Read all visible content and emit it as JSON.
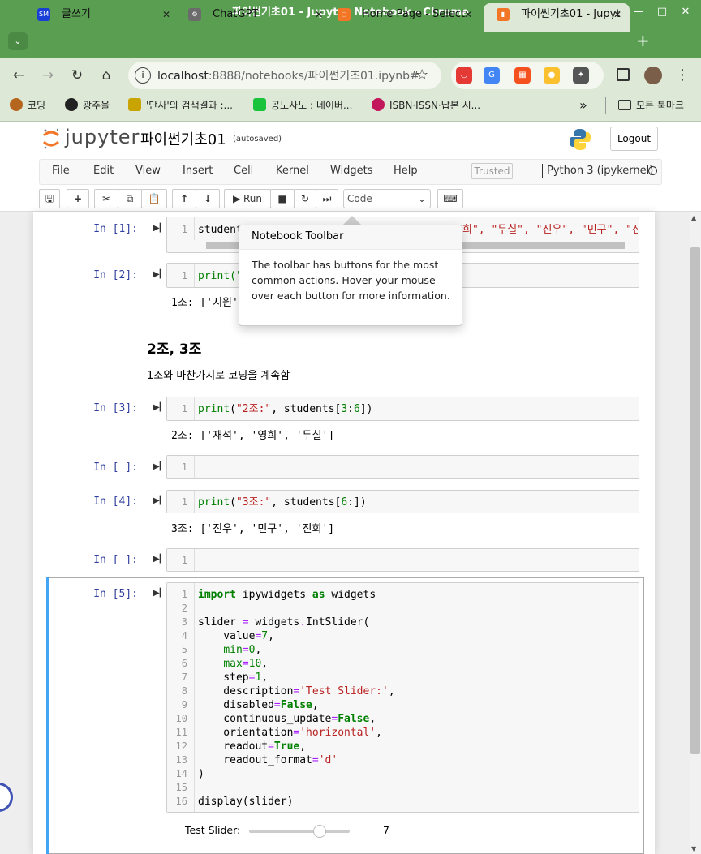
{
  "window": {
    "title": "파이썬기초01 - Jupyter Notebook - Chrome",
    "min": "—",
    "max": "□",
    "close": "✕"
  },
  "tabs": [
    {
      "label": "글쓰기",
      "fav": "SM",
      "color": "#1a3fd6"
    },
    {
      "label": "ChatGPT",
      "fav": "⚙",
      "color": "#6b6b6b"
    },
    {
      "label": "Home Page - Select",
      "fav": "◌",
      "color": "#f37626"
    },
    {
      "label": "파이썬기초01 - Jupyt",
      "fav": "▮",
      "color": "#f37626"
    }
  ],
  "tab_close": "✕",
  "new_tab": "+",
  "nav": {
    "back": "←",
    "forward": "→",
    "reload": "↻",
    "home": "⌂",
    "url_host": "localhost",
    "url_rest": ":8888/notebooks/파이썬기초01.ipynb#",
    "star": "☆",
    "menu": "⋮"
  },
  "bookmarks": [
    {
      "label": "코딩",
      "color": "#b5651d"
    },
    {
      "label": "광주울",
      "color": "#222222"
    },
    {
      "label": "'단사'의 검색결과 :...",
      "color": "#c9a400"
    },
    {
      "label": "공노사노 : 네이버...",
      "color": "#19c33c"
    },
    {
      "label": "ISBN·ISSN·납본 시...",
      "color": "#c2185b"
    }
  ],
  "bookmarks_more": "»",
  "bookmarks_all": "모든 북마크",
  "jupyter": {
    "logo": "jupyter",
    "notebook_name": "파이썬기초01",
    "autosaved": "(autosaved)",
    "logout": "Logout",
    "menus": [
      "File",
      "Edit",
      "View",
      "Insert",
      "Cell",
      "Kernel",
      "Widgets",
      "Help"
    ],
    "trusted": "Trusted",
    "kernel": "Python 3 (ipykernel)",
    "toolbar": {
      "save": "🖫",
      "add": "+",
      "cut": "✂",
      "copy": "⧉",
      "paste": "📋",
      "up": "↑",
      "down": "↓",
      "run": "▶ Run",
      "stop": "■",
      "restart": "↻",
      "ffwd": "⏭",
      "celltype": "Code",
      "keyboard": "⌨"
    }
  },
  "popover": {
    "title": "Notebook Toolbar",
    "body": "The toolbar has buttons for the most common actions. Hover your mouse over each button for more information."
  },
  "cells": {
    "c1": {
      "prompt": "In [1]:",
      "line": "1",
      "code_left": "student",
      "code_right": "희\", \"두칠\", \"진우\", \"민구\", \"진희"
    },
    "c2": {
      "prompt": "In [2]:",
      "line": "1",
      "code": "print(\"",
      "output": "1조: ['지원',"
    },
    "md": {
      "heading": "2조, 3조",
      "para": "1조와 마찬가지로 코딩을 계속함"
    },
    "c3": {
      "prompt": "In [3]:",
      "line": "1",
      "output": "2조: ['재석', '영희', '두칠']"
    },
    "c4": {
      "prompt": "In [ ]:",
      "line": "1"
    },
    "c5": {
      "prompt": "In [4]:",
      "line": "1",
      "output": "3조: ['진우', '민구', '진희']"
    },
    "c6": {
      "prompt": "In [ ]:",
      "line": "1"
    },
    "c7": {
      "prompt": "In [5]:",
      "lines": [
        "1",
        "2",
        "3",
        "4",
        "5",
        "6",
        "7",
        "8",
        "9",
        "10",
        "11",
        "12",
        "13",
        "14",
        "15",
        "16"
      ]
    }
  },
  "widget": {
    "label": "Test Slider:",
    "value": "7",
    "min": 0,
    "max": 10
  }
}
